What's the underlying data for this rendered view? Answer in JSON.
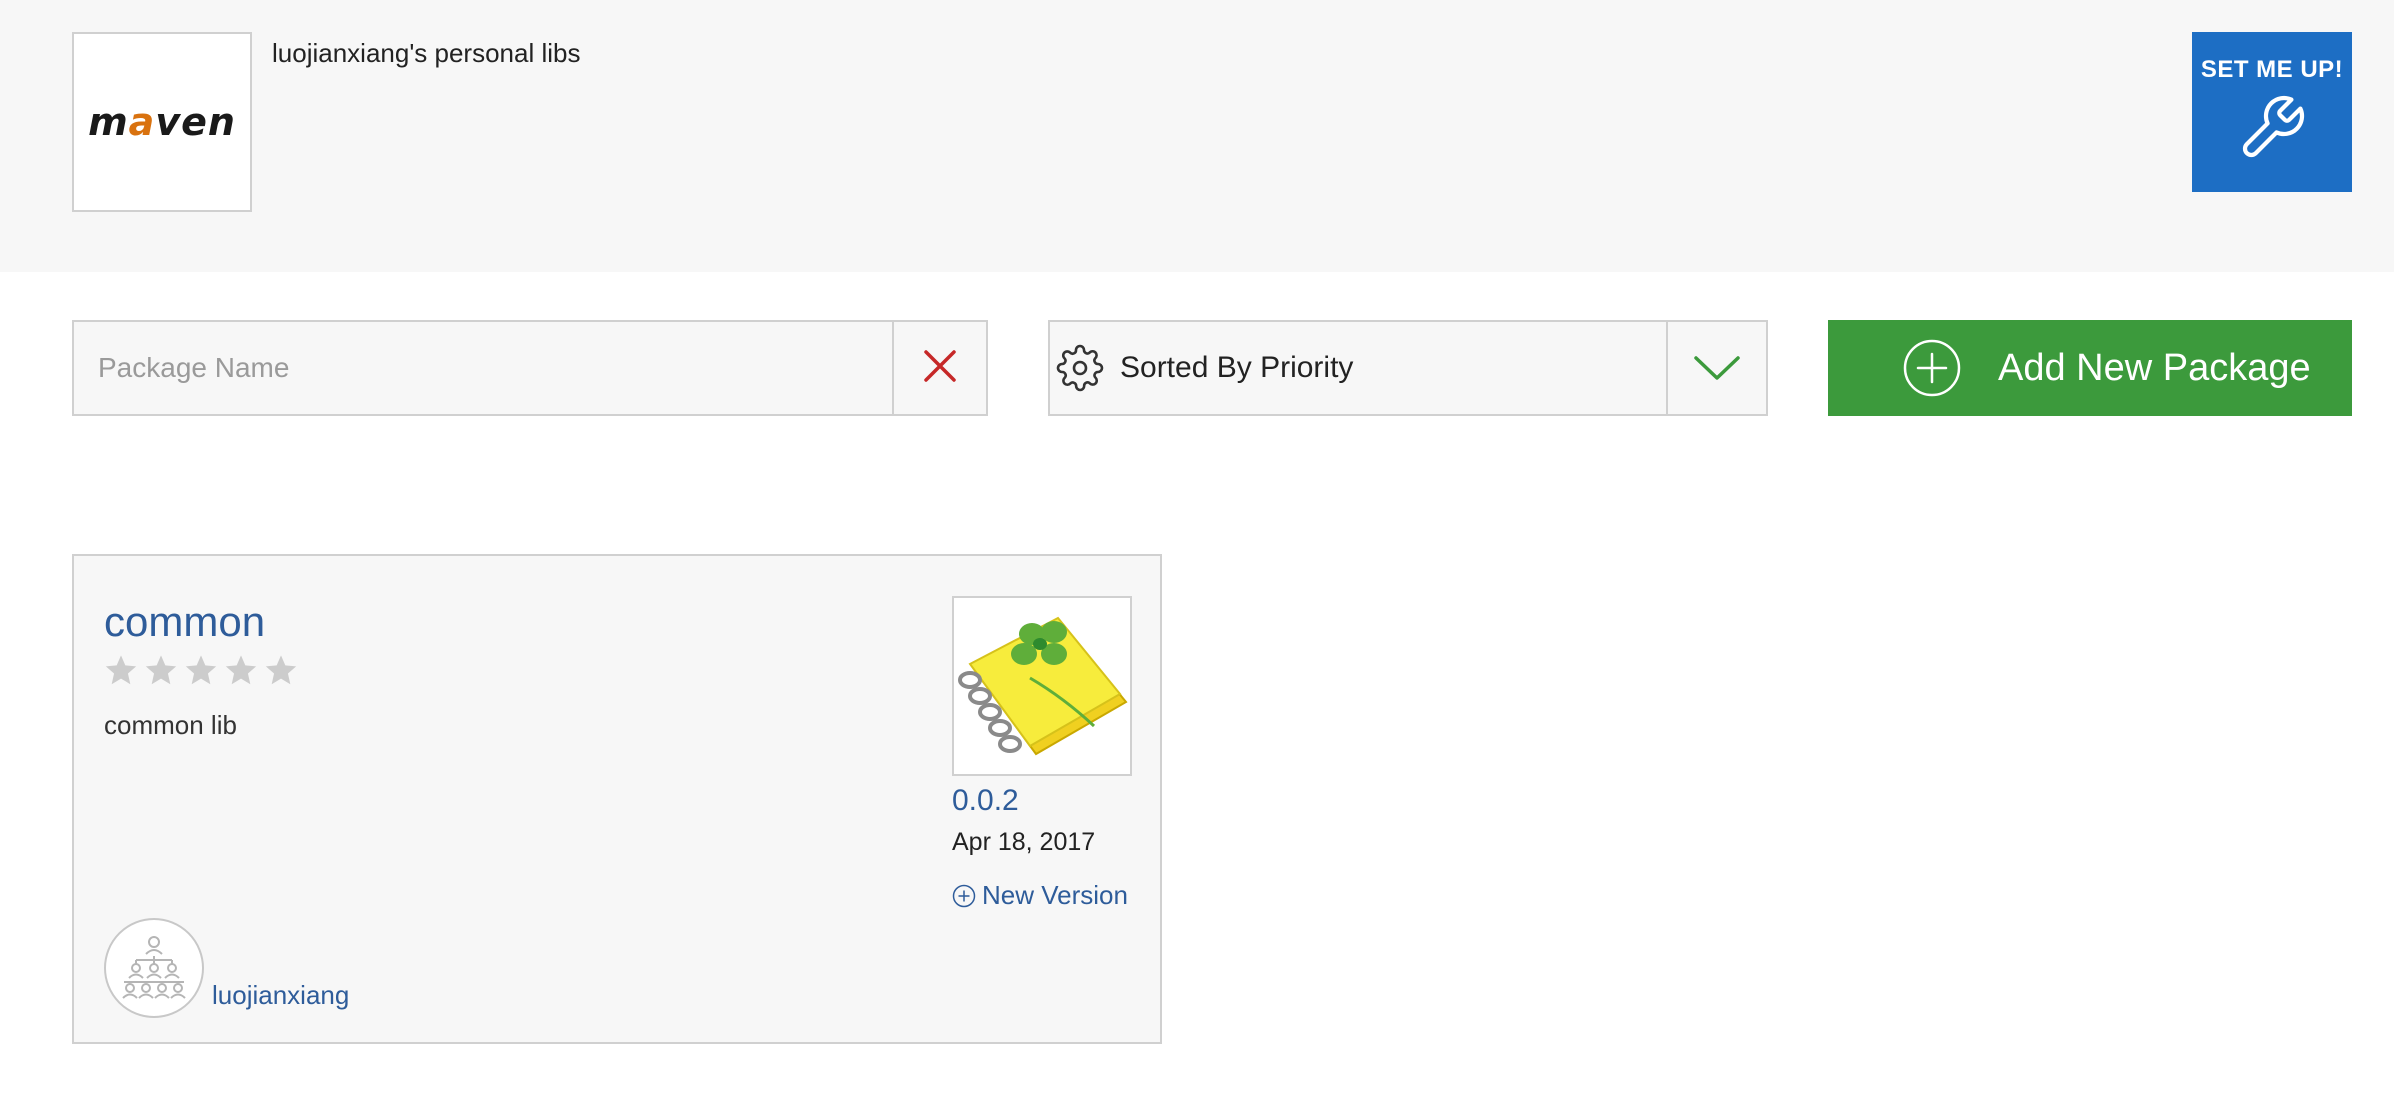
{
  "header": {
    "repo_logo_text_prefix": "m",
    "repo_logo_text_accent": "a",
    "repo_logo_text_suffix": "ven",
    "repo_title": "luojianxiang's personal libs",
    "setup_label": "SET ME UP!"
  },
  "toolbar": {
    "search_placeholder": "Package Name",
    "search_value": "",
    "sort_label": "Sorted By Priority",
    "add_label": "Add New Package"
  },
  "packages": [
    {
      "name": "common",
      "rating": 0,
      "rating_max": 5,
      "description": "common lib",
      "version": "0.0.2",
      "date": "Apr 18, 2017",
      "new_version_label": "New Version",
      "owner": "luojianxiang"
    }
  ],
  "icons": {
    "setup": "wrench-icon",
    "clear": "close-icon",
    "sort": "gear-icon",
    "dropdown": "chevron-down-icon",
    "add": "plus-circle-icon",
    "new_version": "plus-circle-icon",
    "owner": "organization-icon",
    "package": "notebook-clover-icon"
  },
  "colors": {
    "header_bg": "#f7f7f7",
    "setup_button": "#1d6ec4",
    "add_button": "#3c9a3c",
    "link": "#2e5c9a",
    "clear_icon": "#c62828",
    "chevron": "#3c9a3c",
    "star_empty": "#cccccc"
  }
}
